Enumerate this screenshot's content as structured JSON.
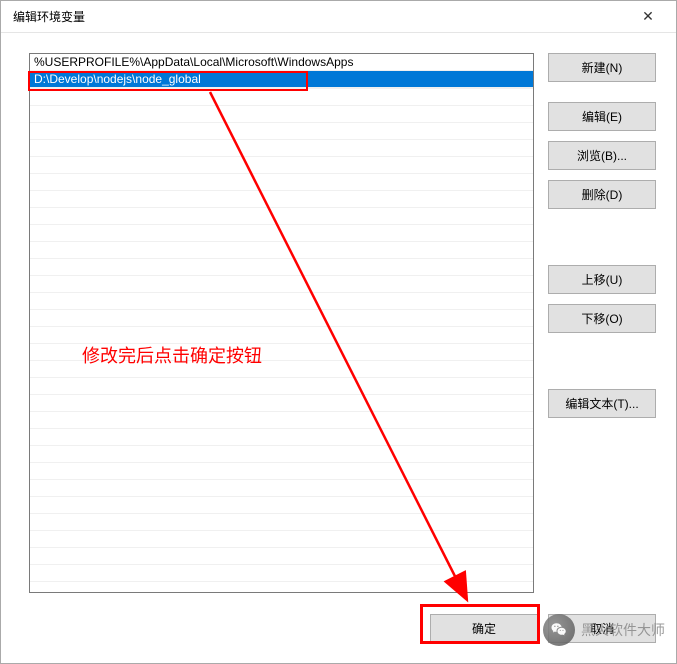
{
  "dialog": {
    "title": "编辑环境变量",
    "close": "✕"
  },
  "list": {
    "items": [
      {
        "text": "%USERPROFILE%\\AppData\\Local\\Microsoft\\WindowsApps",
        "selected": false
      },
      {
        "text": "D:\\Develop\\nodejs\\node_global",
        "selected": true
      }
    ]
  },
  "buttons": {
    "new": "新建(N)",
    "edit": "编辑(E)",
    "browse": "浏览(B)...",
    "delete": "删除(D)",
    "moveUp": "上移(U)",
    "moveDown": "下移(O)",
    "editText": "编辑文本(T)...",
    "ok": "确定",
    "cancel": "取消"
  },
  "annotation": {
    "text": "修改完后点击确定按钮"
  },
  "watermark": {
    "text": "黑火软件大师"
  }
}
